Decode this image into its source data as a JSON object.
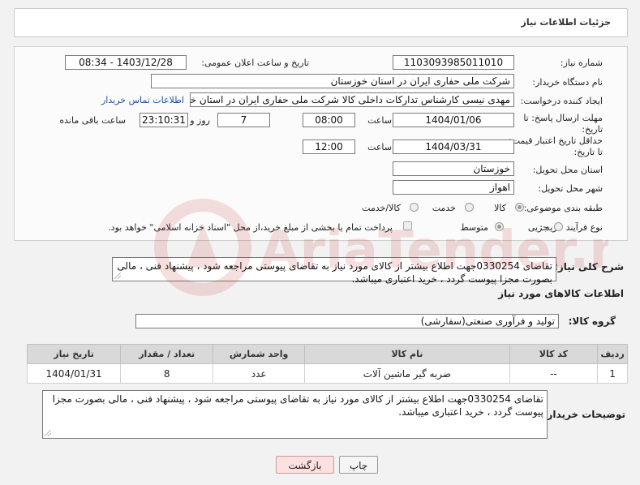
{
  "header": {
    "title": "جزئیات اطلاعات نیاز"
  },
  "form": {
    "need_number_label": "شماره نیاز:",
    "need_number": "1103093985011010",
    "announce_label": "تاریخ و ساعت اعلان عمومی:",
    "announce_value": "1403/12/28 - 08:34",
    "buyer_label": "نام دستگاه خریدار:",
    "buyer_value": "شرکت ملی حفاری ایران در استان خوزستان",
    "creator_label": "ایجاد کننده درخواست:",
    "creator_value": "مهدی نیسی کارشناس تدارکات داخلی کالا شرکت ملی حفاری ایران در استان خوزستان",
    "contact_link": "اطلاعات تماس خریدار",
    "deadline_label": "مهلت ارسال پاسخ: تا تاریخ:",
    "deadline_date": "1404/01/06",
    "time_label": "ساعت",
    "deadline_time": "08:00",
    "days_value": "7",
    "days_label": "روز و",
    "remaining_time": "23:10:31",
    "remaining_label": "ساعت باقی مانده",
    "validity_label": "حداقل تاریخ اعتبار قیمت: تا تاریخ:",
    "validity_date": "1404/03/31",
    "validity_time": "12:00",
    "province_label": "استان محل تحویل:",
    "province_value": "خوزستان",
    "city_label": "شهر محل تحویل:",
    "city_value": "اهواز",
    "category_label": "طبقه بندی موضوعی:",
    "category_options": [
      "کالا",
      "خدمت",
      "کالا/خدمت"
    ],
    "process_label": "نوع فرآیند خرید :",
    "process_options": [
      "جزیی",
      "متوسط"
    ],
    "payment_note": "پرداخت تمام یا بخشی از مبلغ خرید،از محل \"اسناد خزانه اسلامی\" خواهد بود."
  },
  "description": {
    "label": "شرح کلی نیاز:",
    "text": "تقاضای 0330254جهت اطلاع بیشتر از کالای مورد نیاز به تقاضای پیوستی مراجعه شود ، پیشنهاد فنی ، مالی بصورت مجزا پیوست گردد ، خرید اعتباری میباشد."
  },
  "goods": {
    "section_title": "اطلاعات کالاهای مورد نیاز",
    "group_label": "گروه کالا:",
    "group_value": "تولید و فرآوری صنعتی(سفارشی)",
    "columns": [
      "ردیف",
      "کد کالا",
      "نام کالا",
      "واحد شمارش",
      "تعداد / مقدار",
      "تاریخ نیاز"
    ],
    "rows": [
      {
        "row": "1",
        "code": "--",
        "name": "ضربه گیر ماشین آلات",
        "unit": "عدد",
        "qty": "8",
        "date": "1404/01/31"
      }
    ]
  },
  "buyer_notes": {
    "label": "توضیحات خریدار:",
    "text": "تقاضای 0330254جهت اطلاع بیشتر از کالای مورد نیاز به تقاضای پیوستی مراجعه شود ، پیشنهاد فنی ، مالی بصورت مجزا پیوست گردد ، خرید اعتباری میباشد."
  },
  "buttons": {
    "print": "چاپ",
    "back": "بازگشت"
  },
  "watermark": {
    "text": "AriaTender.neT"
  },
  "colors": {
    "link": "#1b4fa8",
    "table_header": "#d9d9d9",
    "back_button": "#fde1e1"
  }
}
